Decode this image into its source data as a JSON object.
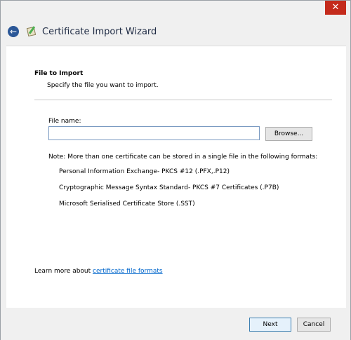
{
  "window": {
    "title": "Certificate Import Wizard",
    "close_glyph": "✕",
    "back_glyph": "←",
    "icons": [
      "back-icon",
      "certificate-icon",
      "close-icon"
    ]
  },
  "page": {
    "heading": "File to Import",
    "subheading": "Specify the file you want to import."
  },
  "file": {
    "label": "File name:",
    "value": "",
    "browse_label": "Browse..."
  },
  "note": "Note:  More than one certificate can be stored in a single file in the following formats:",
  "formats": [
    "Personal Information Exchange- PKCS #12 (.PFX,.P12)",
    "Cryptographic Message Syntax Standard- PKCS #7 Certificates (.P7B)",
    "Microsoft Serialised Certificate Store (.SST)"
  ],
  "learn_more": {
    "prefix": "Learn more about ",
    "link_text": "certificate file formats"
  },
  "footer": {
    "next_label": "Next",
    "cancel_label": "Cancel"
  },
  "colors": {
    "close_button": "#c42b1c",
    "back_button": "#2b5797",
    "link": "#0066cc"
  }
}
